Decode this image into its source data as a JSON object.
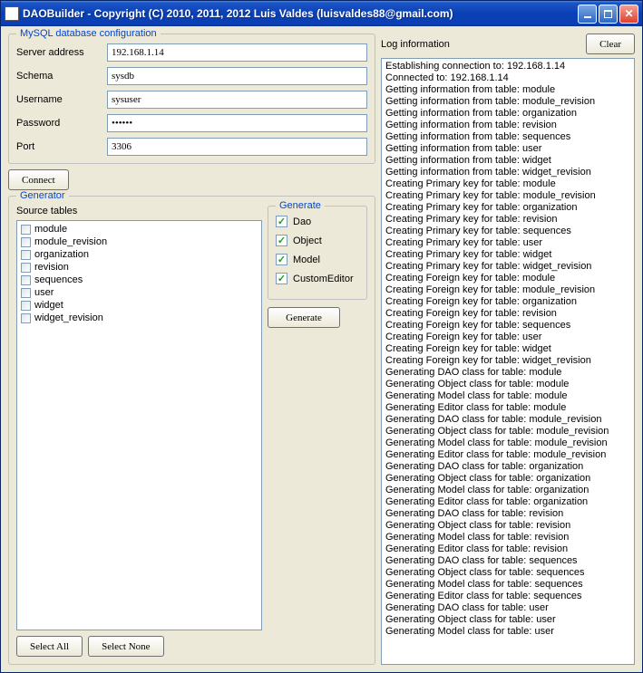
{
  "title": "DAOBuilder - Copyright (C) 2010, 2011, 2012  Luis Valdes (luisvaldes88@gmail.com)",
  "buttons": {
    "clear": "Clear",
    "connect": "Connect",
    "generate": "Generate",
    "select_all": "Select All",
    "select_none": "Select None"
  },
  "db": {
    "group_title": "MySQL database configuration",
    "server_label": "Server address",
    "server_value": "192.168.1.14",
    "schema_label": "Schema",
    "schema_value": "sysdb",
    "username_label": "Username",
    "username_value": "sysuser",
    "password_label": "Password",
    "password_value": "••••••",
    "port_label": "Port",
    "port_value": "3306"
  },
  "generator": {
    "group_title": "Generator",
    "source_label": "Source tables",
    "generate_group": "Generate",
    "tables": [
      "module",
      "module_revision",
      "organization",
      "revision",
      "sequences",
      "user",
      "widget",
      "widget_revision"
    ],
    "options": {
      "dao": "Dao",
      "object": "Object",
      "model": "Model",
      "custom": "CustomEditor"
    }
  },
  "log": {
    "title": "Log information",
    "lines": [
      "Establishing connection to: 192.168.1.14",
      "Connected to: 192.168.1.14",
      "Getting information from table: module",
      "Getting information from table: module_revision",
      "Getting information from table: organization",
      "Getting information from table: revision",
      "Getting information from table: sequences",
      "Getting information from table: user",
      "Getting information from table: widget",
      "Getting information from table: widget_revision",
      "Creating Primary key for table: module",
      "Creating Primary key for table: module_revision",
      "Creating Primary key for table: organization",
      "Creating Primary key for table: revision",
      "Creating Primary key for table: sequences",
      "Creating Primary key for table: user",
      "Creating Primary key for table: widget",
      "Creating Primary key for table: widget_revision",
      "Creating Foreign key for table: module",
      "Creating Foreign key for table: module_revision",
      "Creating Foreign key for table: organization",
      "Creating Foreign key for table: revision",
      "Creating Foreign key for table: sequences",
      "Creating Foreign key for table: user",
      "Creating Foreign key for table: widget",
      "Creating Foreign key for table: widget_revision",
      "Generating DAO class for table: module",
      "Generating Object class for table: module",
      "Generating Model class for table: module",
      "Generating Editor class for table: module",
      "Generating DAO class for table: module_revision",
      "Generating Object class for table: module_revision",
      "Generating Model class for table: module_revision",
      "Generating Editor class for table: module_revision",
      "Generating DAO class for table: organization",
      "Generating Object class for table: organization",
      "Generating Model class for table: organization",
      "Generating Editor class for table: organization",
      "Generating DAO class for table: revision",
      "Generating Object class for table: revision",
      "Generating Model class for table: revision",
      "Generating Editor class for table: revision",
      "Generating DAO class for table: sequences",
      "Generating Object class for table: sequences",
      "Generating Model class for table: sequences",
      "Generating Editor class for table: sequences",
      "Generating DAO class for table: user",
      "Generating Object class for table: user",
      "Generating Model class for table: user"
    ]
  }
}
